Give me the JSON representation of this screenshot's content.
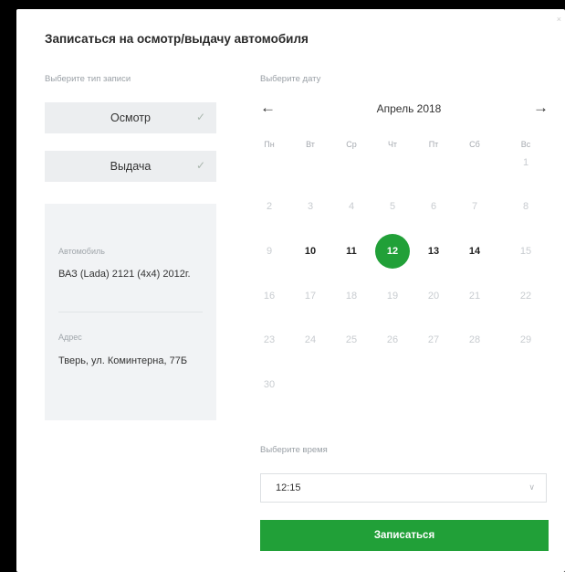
{
  "modal": {
    "title": "Записаться на осмотр/выдачу автомобиля",
    "close_label": "×"
  },
  "left": {
    "type_label": "Выберите тип записи",
    "types": [
      {
        "label": "Осмотр",
        "checked": true
      },
      {
        "label": "Выдача",
        "checked": true
      }
    ],
    "car_label": "Автомобиль",
    "car_value": "ВАЗ (Lada) 2121 (4x4) 2012г.",
    "address_label": "Адрес",
    "address_value": "Тверь, ул. Коминтерна, 77Б"
  },
  "calendar": {
    "date_label": "Выберите дату",
    "month": "Апрель 2018",
    "prev_label": "←",
    "next_label": "→",
    "weekdays": [
      "Пн",
      "Вт",
      "Ср",
      "Чт",
      "Пт",
      "Сб",
      "Вс"
    ],
    "weeks": [
      [
        "",
        "",
        "",
        "",
        "",
        "",
        "1"
      ],
      [
        "2",
        "3",
        "4",
        "5",
        "6",
        "7",
        "8"
      ],
      [
        "9",
        "10",
        "11",
        "12",
        "13",
        "14",
        "15"
      ],
      [
        "16",
        "17",
        "18",
        "19",
        "20",
        "21",
        "22"
      ],
      [
        "23",
        "24",
        "25",
        "26",
        "27",
        "28",
        "29"
      ],
      [
        "30",
        "",
        "",
        "",
        "",
        "",
        ""
      ]
    ],
    "available_days": [
      "10",
      "11",
      "12",
      "13",
      "14"
    ],
    "selected_day": "12"
  },
  "time": {
    "label": "Выберите время",
    "value": "12:15"
  },
  "submit_label": "Записаться",
  "colors": {
    "accent": "#21a038",
    "backdrop": "#000000",
    "panel": "#f1f3f5"
  },
  "icons": {
    "check": "check-icon",
    "chevron": "chevron-down-icon",
    "prev": "arrow-left-icon",
    "next": "arrow-right-icon"
  }
}
